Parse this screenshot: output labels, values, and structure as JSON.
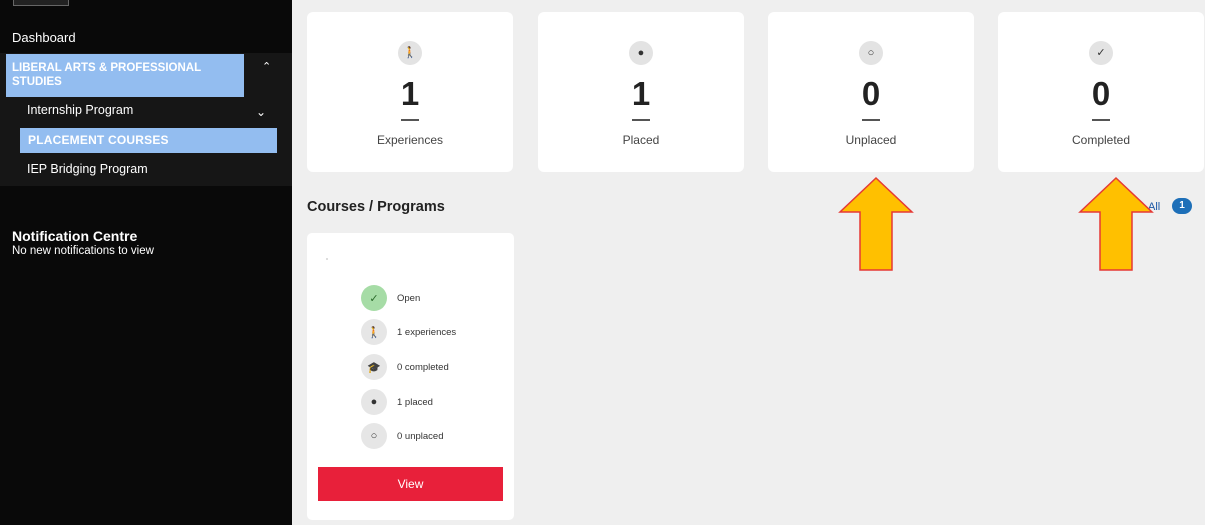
{
  "sidebar": {
    "dashboard": "Dashboard",
    "group_label": "LIBERAL ARTS & PROFESSIONAL STUDIES",
    "items": [
      {
        "label": "Internship Program"
      },
      {
        "label": "PLACEMENT COURSES"
      },
      {
        "label": "IEP Bridging Program"
      }
    ],
    "notification_title": "Notification Centre",
    "notification_text": "No new notifications to view"
  },
  "stats": [
    {
      "value": "1",
      "label": "Experiences",
      "icon": "walking-person-icon"
    },
    {
      "value": "1",
      "label": "Placed",
      "icon": "person-icon"
    },
    {
      "value": "0",
      "label": "Unplaced",
      "icon": "person-outline-icon"
    },
    {
      "value": "0",
      "label": "Completed",
      "icon": "check-icon"
    }
  ],
  "courses": {
    "title": "Courses / Programs",
    "all_label": "All",
    "all_count": "1",
    "card": {
      "rows": [
        {
          "label": "Open",
          "icon": "check-icon"
        },
        {
          "label": "1 experiences",
          "icon": "walking-person-icon"
        },
        {
          "label": "0 completed",
          "icon": "graduation-cap-icon"
        },
        {
          "label": "1 placed",
          "icon": "person-icon"
        },
        {
          "label": "0 unplaced",
          "icon": "person-outline-icon"
        }
      ],
      "view_label": "View"
    }
  },
  "colors": {
    "sidebar_bg": "#090909",
    "highlight": "#93bdf0",
    "view_button": "#e8203a",
    "arrow_fill": "#ffc000",
    "arrow_stroke": "#e53935"
  }
}
